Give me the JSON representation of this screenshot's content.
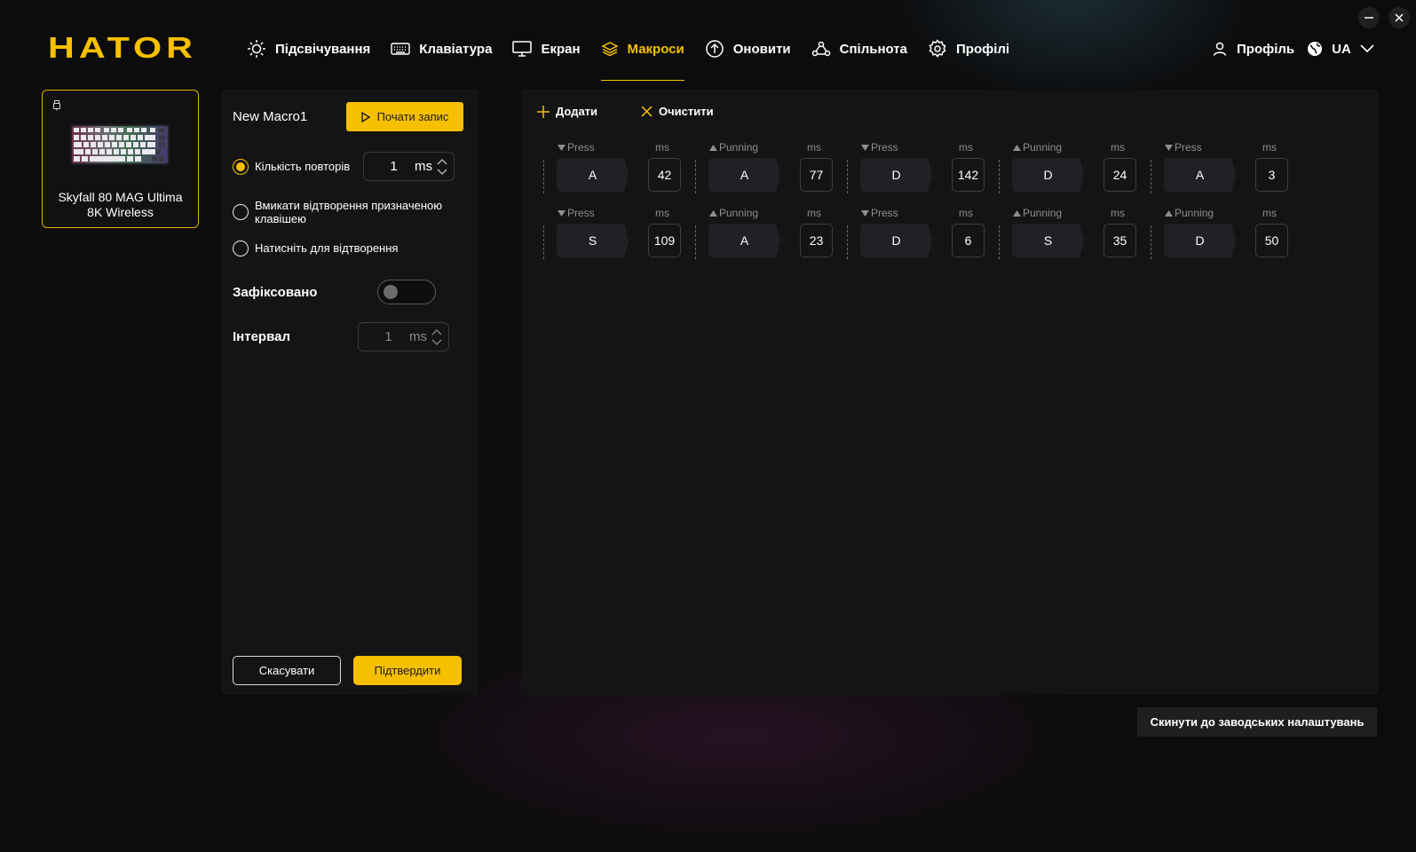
{
  "brand": {
    "logo_text": "HATOR",
    "accent_color": "#f6c000"
  },
  "nav": [
    {
      "icon": "sun-icon",
      "label": "Підсвічування"
    },
    {
      "icon": "keyboard-icon",
      "label": "Клавіатура"
    },
    {
      "icon": "monitor-icon",
      "label": "Екран"
    },
    {
      "icon": "layers-icon",
      "label": "Макроси",
      "active": true
    },
    {
      "icon": "update-icon",
      "label": "Оновити"
    },
    {
      "icon": "community-icon",
      "label": "Спільнота"
    },
    {
      "icon": "gear-icon",
      "label": "Профілі"
    }
  ],
  "account": {
    "profile_label": "Профіль",
    "language": "UA"
  },
  "device": {
    "name": "Skyfall 80 MAG Ultima 8K Wireless"
  },
  "macro_settings": {
    "name": "New Macro1",
    "record_label": "Почати запис",
    "repeat_label": "Кількість повторів",
    "repeat_value": "1",
    "repeat_unit": "ms",
    "assigned_key_label": "Вмикати відтворення призначеною клавішею",
    "press_to_play_label": "Натисніть для відтворення",
    "fixed_label": "Зафіксовано",
    "interval_label": "Інтервал",
    "interval_value": "1",
    "interval_unit": "ms",
    "cancel_label": "Скасувати",
    "confirm_label": "Підтвердити"
  },
  "editor": {
    "add_label": "Додати",
    "clear_label": "Очистити",
    "ms_header": "ms",
    "rows": [
      [
        {
          "type": "Press",
          "dir": "down",
          "key": "A",
          "ms": "42"
        },
        {
          "type": "Punning",
          "dir": "up",
          "key": "A",
          "ms": "77"
        },
        {
          "type": "Press",
          "dir": "down",
          "key": "D",
          "ms": "142"
        },
        {
          "type": "Punning",
          "dir": "up",
          "key": "D",
          "ms": "24"
        },
        {
          "type": "Press",
          "dir": "down",
          "key": "A",
          "ms": "3"
        }
      ],
      [
        {
          "type": "Press",
          "dir": "down",
          "key": "S",
          "ms": "109"
        },
        {
          "type": "Punning",
          "dir": "up",
          "key": "A",
          "ms": "23"
        },
        {
          "type": "Press",
          "dir": "down",
          "key": "D",
          "ms": "6"
        },
        {
          "type": "Punning",
          "dir": "up",
          "key": "S",
          "ms": "35"
        },
        {
          "type": "Punning",
          "dir": "up",
          "key": "D",
          "ms": "50"
        }
      ]
    ]
  },
  "footer": {
    "reset_label": "Скинути до заводських налаштувань"
  }
}
